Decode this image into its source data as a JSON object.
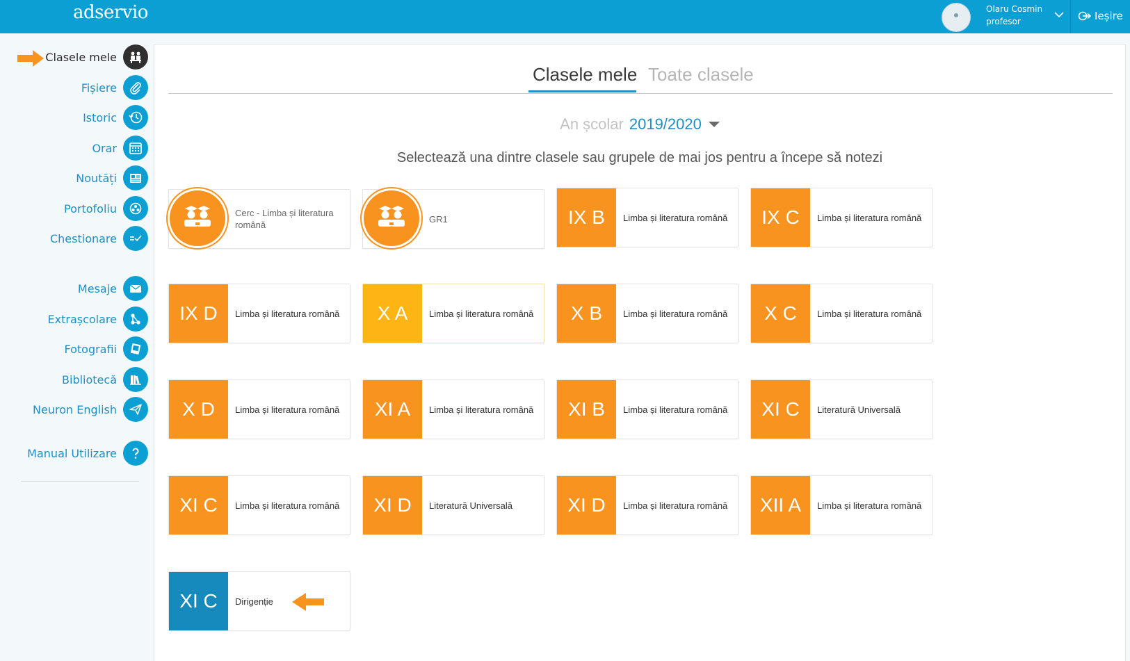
{
  "header": {
    "logo": "adservio",
    "user_name": "Olaru Cosmin",
    "user_role": "profesor",
    "logout_label": "Ieșire"
  },
  "sidebar": {
    "items": [
      {
        "label": "Clasele mele",
        "icon": "classroom-icon",
        "active": true
      },
      {
        "label": "Fișiere",
        "icon": "paperclip-icon"
      },
      {
        "label": "Istoric",
        "icon": "history-icon"
      },
      {
        "label": "Orar",
        "icon": "calendar-icon"
      },
      {
        "label": "Noutăți",
        "icon": "news-icon"
      },
      {
        "label": "Portofoliu",
        "icon": "portfolio-icon"
      },
      {
        "label": "Chestionare",
        "icon": "checklist-icon"
      },
      {
        "label": "Mesaje",
        "icon": "envelope-icon"
      },
      {
        "label": "Extrașcolare",
        "icon": "activities-icon"
      },
      {
        "label": "Fotografii",
        "icon": "photos-icon"
      },
      {
        "label": "Bibliotecă",
        "icon": "library-icon"
      },
      {
        "label": "Neuron English",
        "icon": "paper-plane-icon"
      },
      {
        "label": "Manual Utilizare",
        "icon": "question-icon"
      }
    ]
  },
  "main": {
    "tabs": [
      {
        "label": "Clasele mele",
        "active": true
      },
      {
        "label": "Toate clasele",
        "active": false
      }
    ],
    "school_year_label": "An școlar",
    "school_year_value": "2019/2020",
    "instruction": "Selectează una dintre clasele sau grupele de mai jos pentru a începe să notezi",
    "cards": [
      {
        "code": "",
        "subject": "Cerc - Limba și literatura română",
        "style": "group"
      },
      {
        "code": "",
        "subject": "GR1",
        "style": "group"
      },
      {
        "code": "IX B",
        "subject": "Limba și literatura română",
        "style": "orange"
      },
      {
        "code": "IX C",
        "subject": "Limba și literatura română",
        "style": "orange"
      },
      {
        "code": "IX D",
        "subject": "Limba și literatura română",
        "style": "orange"
      },
      {
        "code": "X A",
        "subject": "Limba și literatura română",
        "style": "yellow"
      },
      {
        "code": "X B",
        "subject": "Limba și literatura română",
        "style": "orange"
      },
      {
        "code": "X C",
        "subject": "Limba și literatura română",
        "style": "orange"
      },
      {
        "code": "X D",
        "subject": "Limba și literatura română",
        "style": "orange"
      },
      {
        "code": "XI A",
        "subject": "Limba și literatura română",
        "style": "orange"
      },
      {
        "code": "XI B",
        "subject": "Limba și literatura română",
        "style": "orange"
      },
      {
        "code": "XI C",
        "subject": "Literatură Universală",
        "style": "orange"
      },
      {
        "code": "XI C",
        "subject": "Limba și literatura română",
        "style": "orange"
      },
      {
        "code": "XI D",
        "subject": "Literatură Universală",
        "style": "orange"
      },
      {
        "code": "XI D",
        "subject": "Limba și literatura română",
        "style": "orange"
      },
      {
        "code": "XII A",
        "subject": "Limba și literatura română",
        "style": "orange"
      },
      {
        "code": "XI C",
        "subject": "Dirigenție",
        "style": "blue"
      }
    ]
  },
  "colors": {
    "topbar": "#0c9fd3",
    "accent_blue": "#1d8fc4",
    "orange": "#f7931e",
    "yellow": "#fcb514",
    "homeroom_blue": "#1689bd"
  }
}
